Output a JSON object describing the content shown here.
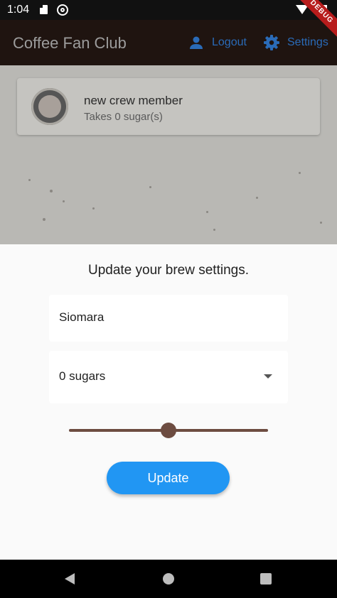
{
  "status_bar": {
    "time": "1:04",
    "debug_label": "DEBUG"
  },
  "app_bar": {
    "title": "Coffee Fan Club",
    "logout_label": "Logout",
    "settings_label": "Settings"
  },
  "crew_list": [
    {
      "name": "new crew member",
      "sugars_text": "Takes 0 sugar(s)"
    }
  ],
  "settings_sheet": {
    "title": "Update your brew settings.",
    "name_value": "Siomara",
    "sugars_selected": "0 sugars",
    "strength_level": 0.5,
    "update_label": "Update"
  },
  "colors": {
    "app_bar": "#1f1410",
    "accent": "#2196f3",
    "slider": "#6d4c41",
    "action_text": "#2a6bb8"
  },
  "icons": [
    "sd-card-icon",
    "sync-icon",
    "wifi-icon",
    "battery-icon",
    "person-icon",
    "gear-icon",
    "coffee-cup-icon",
    "dropdown-arrow-icon",
    "back-icon",
    "home-icon",
    "recents-icon"
  ]
}
